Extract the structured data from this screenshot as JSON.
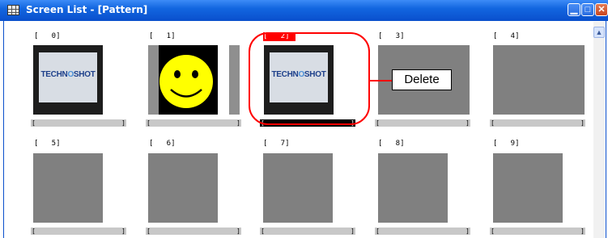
{
  "window": {
    "title": "Screen List - [Pattern]",
    "controls": [
      "minimize-icon",
      "maximize-icon",
      "close-icon"
    ],
    "title_color": "#0a4fcc"
  },
  "screens": [
    {
      "number": "[   0]",
      "label_open": "[",
      "label_close": "]",
      "thumbnail": "device-technoshot"
    },
    {
      "number": "[   1]",
      "label_open": "[",
      "label_close": "]",
      "thumbnail": "smiley-face"
    },
    {
      "number": "[   2]",
      "label_open": "[",
      "label_close": "]",
      "thumbnail": "device-technoshot",
      "selected": true
    },
    {
      "number": "[   3]",
      "label_open": "[",
      "label_close": "]",
      "thumbnail": "blank"
    },
    {
      "number": "[   4]",
      "label_open": "[",
      "label_close": "]",
      "thumbnail": "blank"
    },
    {
      "number": "[   5]",
      "label_open": "[",
      "label_close": "]",
      "thumbnail": "blank"
    },
    {
      "number": "[   6]",
      "label_open": "[",
      "label_close": "]",
      "thumbnail": "blank"
    },
    {
      "number": "[   7]",
      "label_open": "[",
      "label_close": "]",
      "thumbnail": "blank"
    },
    {
      "number": "[   8]",
      "label_open": "[",
      "label_close": "]",
      "thumbnail": "blank"
    },
    {
      "number": "[   9]",
      "label_open": "[",
      "label_close": "]",
      "thumbnail": "blank"
    }
  ],
  "device_logo": {
    "left": "TECHN",
    "o": "O",
    "right": "SHOT"
  },
  "annotation": {
    "text": "Delete",
    "color": "#ff0000"
  },
  "scrollbar": {
    "up_icon": "chevron-up-icon"
  }
}
